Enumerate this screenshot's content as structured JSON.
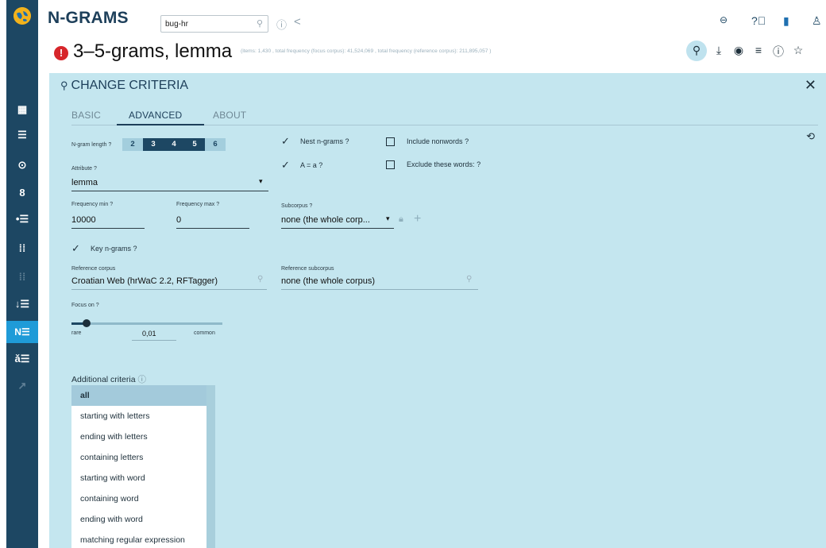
{
  "app": {
    "title": "N-GRAMS"
  },
  "corpus_search": {
    "value": "bug-hr"
  },
  "result": {
    "title": "3–5-grams, lemma",
    "stats": "(items: 1,430 , total frequency (focus corpus): 41,524,069 , total frequency (reference corpus): 211,895,057 )"
  },
  "panel": {
    "title": "CHANGE CRITERIA"
  },
  "tabs": [
    {
      "label": "BASIC"
    },
    {
      "label": "ADVANCED"
    },
    {
      "label": "ABOUT"
    }
  ],
  "ngram_length": {
    "label": "N-gram length",
    "help": "?",
    "options": [
      "2",
      "3",
      "4",
      "5",
      "6"
    ],
    "selected": [
      "3",
      "4",
      "5"
    ]
  },
  "attribute": {
    "label": "Attribute",
    "help": "?",
    "value": "lemma"
  },
  "frequency_min": {
    "label": "Frequency min",
    "help": "?",
    "value": "10000"
  },
  "frequency_max": {
    "label": "Frequency max",
    "help": "?",
    "value": "0"
  },
  "subcorpus": {
    "label": "Subcorpus",
    "help": "?",
    "value": "none (the whole corp..."
  },
  "nest_ngrams": {
    "label": "Nest n-grams",
    "help": "?",
    "checked": true
  },
  "a_equals_a": {
    "label": "A = a",
    "help": "?",
    "checked": true
  },
  "include_nonwords": {
    "label": "Include nonwords",
    "help": "?",
    "checked": false
  },
  "exclude_words": {
    "label": "Exclude these words:",
    "help": "?",
    "checked": false
  },
  "key_ngrams": {
    "label": "Key n-grams",
    "help": "?",
    "checked": true
  },
  "reference_corpus": {
    "label": "Reference corpus",
    "value": "Croatian Web (hrWaC 2.2, RFTagger)"
  },
  "reference_subcorpus": {
    "label": "Reference subcorpus",
    "value": "none (the whole corpus)"
  },
  "focus_on": {
    "label": "Focus on",
    "help": "?",
    "value": "0,01",
    "min_label": "rare",
    "max_label": "common",
    "slider_fraction": 0.1
  },
  "additional_criteria": {
    "label": "Additional criteria",
    "options": [
      "all",
      "starting with letters",
      "ending with letters",
      "containing letters",
      "starting with word",
      "containing word",
      "ending with word",
      "matching regular expression"
    ],
    "selected": "all"
  },
  "colors": {
    "sidebar": "#1d4763",
    "panel": "#c4e6ef",
    "active_nav": "#1f9bd8",
    "error": "#d7262b"
  },
  "icons": {
    "header": [
      "info-icon",
      "share-icon",
      "link-icon",
      "help-icon",
      "feedback-icon",
      "user-icon"
    ],
    "toolbar": [
      "search-icon",
      "download-icon",
      "eye-icon",
      "filter-icon",
      "info-icon",
      "star-icon"
    ]
  }
}
